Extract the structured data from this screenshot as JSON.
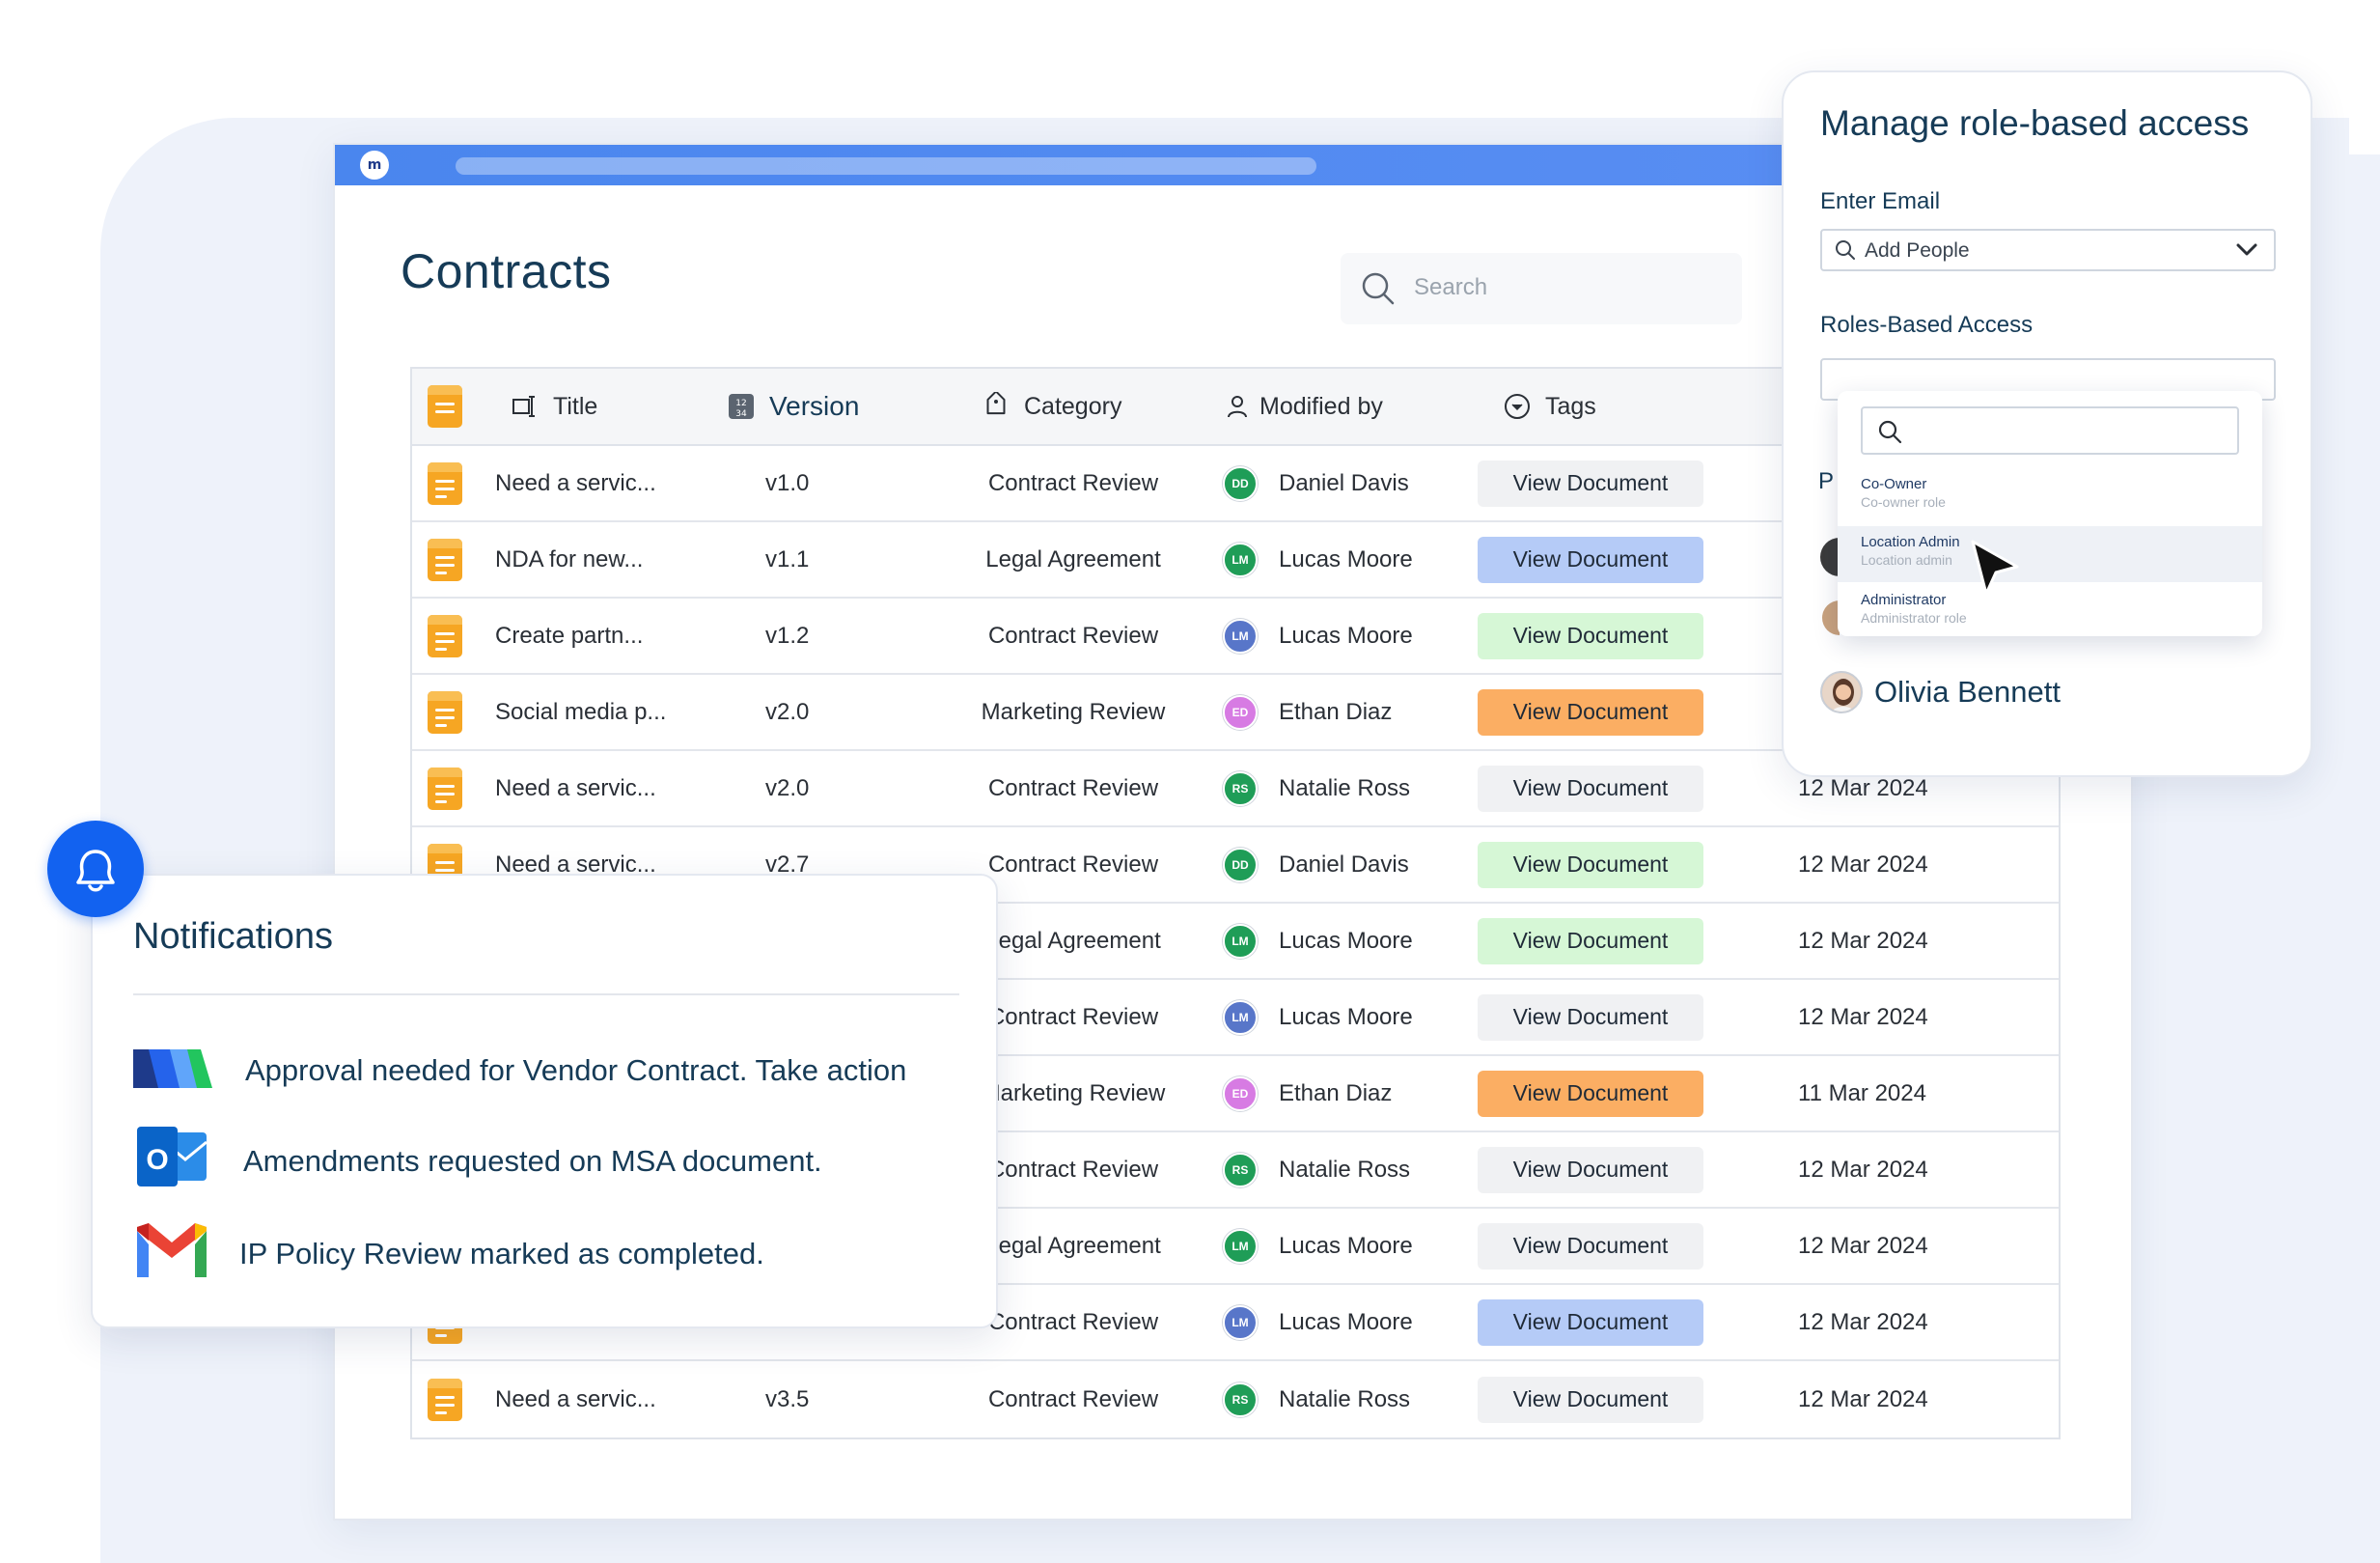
{
  "app": {
    "logo_text": "m",
    "page_title": "Contracts",
    "search_placeholder": "Search"
  },
  "table": {
    "headers": {
      "title": "Title",
      "version": "Version",
      "category": "Category",
      "modified_by": "Modified by",
      "tags": "Tags"
    },
    "rows": [
      {
        "title": "Need a servic...",
        "version": "v1.0",
        "category": "Contract Review",
        "initials": "DD",
        "avatar_color": "#1f9d57",
        "modified_by": "Daniel Davis",
        "button": "View Document",
        "button_color": "#f0f1f3",
        "date": ""
      },
      {
        "title": "NDA for new...",
        "version": "v1.1",
        "category": "Legal Agreement",
        "initials": "LM",
        "avatar_color": "#1f9d57",
        "modified_by": "Lucas Moore",
        "button": "View Document",
        "button_color": "#b5cbf7",
        "date": ""
      },
      {
        "title": "Create partn...",
        "version": "v1.2",
        "category": "Contract Review",
        "initials": "LM",
        "avatar_color": "#5876c9",
        "modified_by": "Lucas Moore",
        "button": "View Document",
        "button_color": "#d6f7d6",
        "date": ""
      },
      {
        "title": "Social media p...",
        "version": "v2.0",
        "category": "Marketing Review",
        "initials": "ED",
        "avatar_color": "#d77be3",
        "modified_by": "Ethan Diaz",
        "button": "View Document",
        "button_color": "#fbae63",
        "date": ""
      },
      {
        "title": "Need a servic...",
        "version": "v2.0",
        "category": "Contract Review",
        "initials": "RS",
        "avatar_color": "#1f9d57",
        "modified_by": "Natalie Ross",
        "button": "View Document",
        "button_color": "#f0f1f3",
        "date": "12 Mar 2024"
      },
      {
        "title": "Need a servic...",
        "version": "v2.7",
        "category": "Contract Review",
        "initials": "DD",
        "avatar_color": "#1f9d57",
        "modified_by": "Daniel Davis",
        "button": "View Document",
        "button_color": "#d6f7d6",
        "date": "12 Mar 2024"
      },
      {
        "title": "",
        "version": "",
        "category": "Legal Agreement",
        "initials": "LM",
        "avatar_color": "#1f9d57",
        "modified_by": "Lucas Moore",
        "button": "View Document",
        "button_color": "#d6f7d6",
        "date": "12 Mar 2024"
      },
      {
        "title": "",
        "version": "",
        "category": "Contract Review",
        "initials": "LM",
        "avatar_color": "#5876c9",
        "modified_by": "Lucas Moore",
        "button": "View Document",
        "button_color": "#f0f1f3",
        "date": "12 Mar 2024"
      },
      {
        "title": "",
        "version": "",
        "category": "Marketing Review",
        "initials": "ED",
        "avatar_color": "#d77be3",
        "modified_by": "Ethan Diaz",
        "button": "View Document",
        "button_color": "#fbae63",
        "date": "11 Mar 2024"
      },
      {
        "title": "",
        "version": "",
        "category": "Contract Review",
        "initials": "RS",
        "avatar_color": "#1f9d57",
        "modified_by": "Natalie Ross",
        "button": "View Document",
        "button_color": "#f0f1f3",
        "date": "12 Mar 2024"
      },
      {
        "title": "",
        "version": "",
        "category": "Legal Agreement",
        "initials": "LM",
        "avatar_color": "#1f9d57",
        "modified_by": "Lucas Moore",
        "button": "View Document",
        "button_color": "#f0f1f3",
        "date": "12 Mar 2024"
      },
      {
        "title": "",
        "version": "",
        "category": "Contract Review",
        "initials": "LM",
        "avatar_color": "#5876c9",
        "modified_by": "Lucas Moore",
        "button": "View Document",
        "button_color": "#b5cbf7",
        "date": "12 Mar 2024"
      },
      {
        "title": "Need a servic...",
        "version": "v3.5",
        "category": "Contract Review",
        "initials": "RS",
        "avatar_color": "#1f9d57",
        "modified_by": "Natalie Ross",
        "button": "View Document",
        "button_color": "#f0f1f3",
        "date": "12 Mar 2024"
      }
    ]
  },
  "role_panel": {
    "title": "Manage role-based access",
    "email_label": "Enter Email",
    "email_placeholder": "Add People",
    "roles_label": "Roles-Based Access",
    "options": [
      {
        "name": "Co-Owner",
        "sub": "Co-owner role"
      },
      {
        "name": "Location Admin",
        "sub": "Location admin"
      },
      {
        "name": "Administrator",
        "sub": "Administrator role"
      }
    ],
    "partial_label": "P",
    "person_name": "Olivia Bennett"
  },
  "notifications": {
    "title": "Notifications",
    "items": [
      {
        "icon": "app-logo-icon",
        "text": "Approval needed for Vendor Contract. Take action"
      },
      {
        "icon": "outlook-icon",
        "text": "Amendments requested on MSA document."
      },
      {
        "icon": "gmail-icon",
        "text": "IP Policy Review marked as completed."
      }
    ]
  },
  "colors": {
    "accent": "#1262f0",
    "heading": "#163b57",
    "doc_icon": "#f6a623"
  }
}
